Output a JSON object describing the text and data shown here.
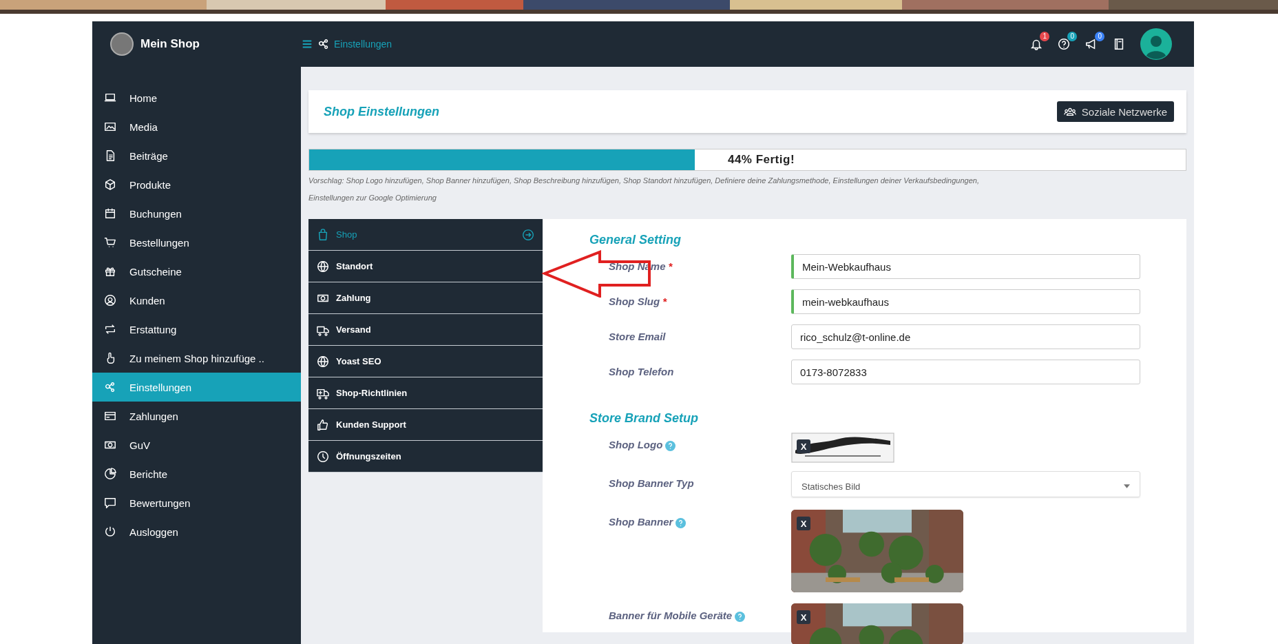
{
  "header": {
    "shop_name": "Mein Shop",
    "breadcrumb": "Einstellungen",
    "badges": [
      {
        "count": "1",
        "color": "#e5484d"
      },
      {
        "count": "0",
        "color": "#17a2b8"
      },
      {
        "count": "0",
        "color": "#3b82f6"
      }
    ]
  },
  "sidebar": {
    "items": [
      {
        "label": "Home",
        "selected": false
      },
      {
        "label": "Media",
        "selected": false
      },
      {
        "label": "Beiträge",
        "selected": false
      },
      {
        "label": "Produkte",
        "selected": false
      },
      {
        "label": "Buchungen",
        "selected": false
      },
      {
        "label": "Bestellungen",
        "selected": false
      },
      {
        "label": "Gutscheine",
        "selected": false
      },
      {
        "label": "Kunden",
        "selected": false
      },
      {
        "label": "Erstattung",
        "selected": false
      },
      {
        "label": "Zu meinem Shop hinzufüge ..",
        "selected": false
      },
      {
        "label": "Einstellungen",
        "selected": true
      },
      {
        "label": "Zahlungen",
        "selected": false
      },
      {
        "label": "GuV",
        "selected": false
      },
      {
        "label": "Berichte",
        "selected": false
      },
      {
        "label": "Bewertungen",
        "selected": false
      },
      {
        "label": "Ausloggen",
        "selected": false
      }
    ]
  },
  "page": {
    "title": "Shop Einstellungen",
    "social_button": "Soziale Netzwerke"
  },
  "progress": {
    "level": 0.44,
    "label": "44% Fertig!",
    "suggestion": "Vorschlag: Shop Logo hinzufügen, Shop Banner hinzufügen, Shop Beschreibung hinzufügen, Shop Standort hinzufügen, Definiere deine Zahlungsmethode, Einstellungen deiner Verkaufsbedingungen, Einstellungen zur Google Optimierung"
  },
  "tabs": [
    {
      "label": "Shop",
      "selected": true
    },
    {
      "label": "Standort",
      "selected": false
    },
    {
      "label": "Zahlung",
      "selected": false
    },
    {
      "label": "Versand",
      "selected": false
    },
    {
      "label": "Yoast SEO",
      "selected": false
    },
    {
      "label": "Shop-Richtlinien",
      "selected": false
    },
    {
      "label": "Kunden Support",
      "selected": false
    },
    {
      "label": "Öffnungszeiten",
      "selected": false
    }
  ],
  "sections": [
    {
      "heading": "General Setting",
      "fields": [
        {
          "kind": "input",
          "label": "Shop Name",
          "mark": "*",
          "valid": true,
          "value": "Mein-Webkaufhaus"
        },
        {
          "kind": "input",
          "label": "Shop Slug",
          "mark": "*",
          "valid": true,
          "value": "mein-webkaufhaus"
        },
        {
          "kind": "input",
          "label": "Store Email",
          "valid": false,
          "value": "rico_schulz@t-online.de"
        },
        {
          "kind": "input",
          "label": "Shop Telefon",
          "valid": false,
          "value": "0173-8072833"
        }
      ]
    },
    {
      "heading": "Store Brand Setup",
      "fields": [
        {
          "kind": "logo",
          "label": "Shop Logo",
          "help": true,
          "remove": "X"
        },
        {
          "kind": "select",
          "label": "Shop Banner Typ",
          "value": "Statisches Bild"
        },
        {
          "label": "Shop Banner",
          "help": true,
          "remove": "X"
        },
        {
          "label": "Banner für Mobile Geräte",
          "help": true,
          "remove": "X"
        }
      ]
    }
  ]
}
